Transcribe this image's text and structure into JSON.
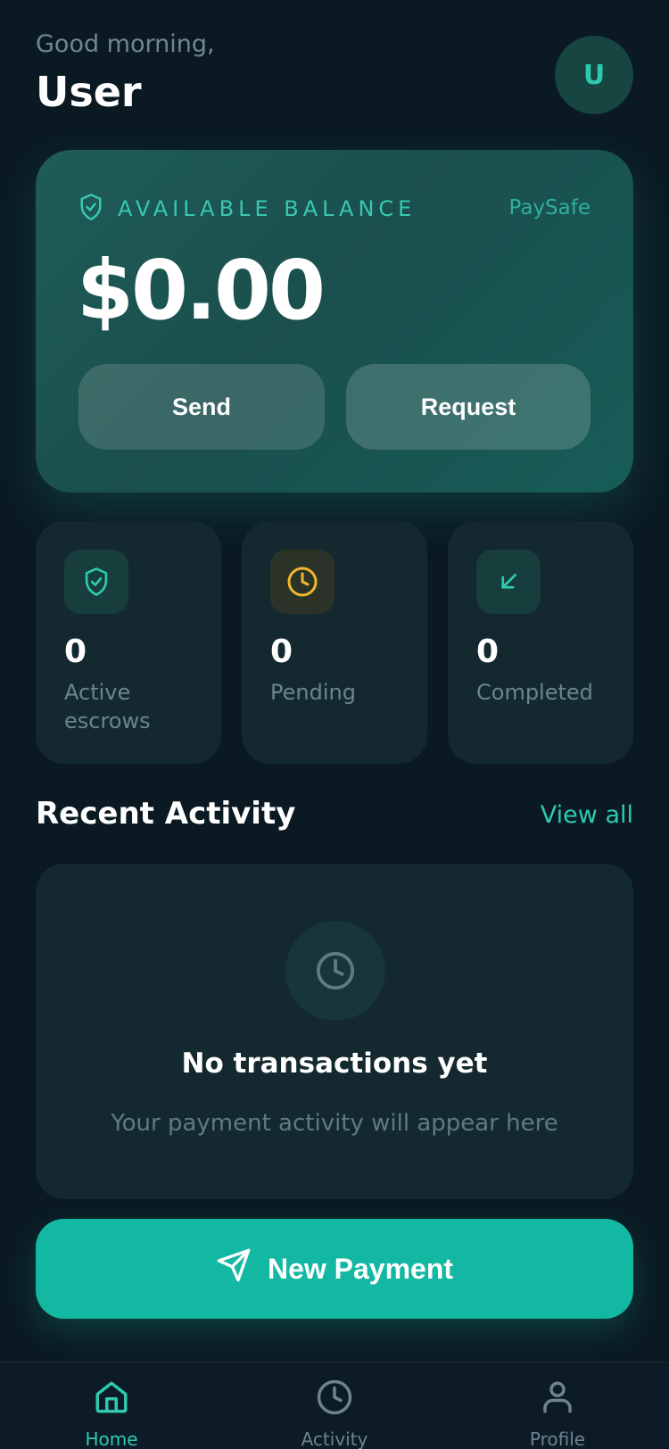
{
  "header": {
    "greeting": "Good morning,",
    "username": "User",
    "avatar_initial": "U"
  },
  "balance_card": {
    "label": "AVAILABLE BALANCE",
    "brand": "PaySafe",
    "amount": "$0.00",
    "send_label": "Send",
    "request_label": "Request",
    "icon": "shield-check-icon"
  },
  "stats": [
    {
      "value": "0",
      "label": "Active escrows",
      "icon": "shield-check-icon",
      "color": "#2ec9b0"
    },
    {
      "value": "0",
      "label": "Pending",
      "icon": "clock-icon",
      "color": "#f0b62e"
    },
    {
      "value": "0",
      "label": "Completed",
      "icon": "arrow-down-left-icon",
      "color": "#2ec9b0"
    }
  ],
  "recent_activity": {
    "title": "Recent Activity",
    "view_all": "View all",
    "empty_title": "No transactions yet",
    "empty_subtitle": "Your payment activity will appear here",
    "empty_icon": "clock-icon"
  },
  "new_payment": {
    "label": "New Payment",
    "icon": "send-icon"
  },
  "nav": {
    "items": [
      {
        "label": "Home",
        "icon": "home-icon",
        "active": true
      },
      {
        "label": "Activity",
        "icon": "clock-icon",
        "active": false
      },
      {
        "label": "Profile",
        "icon": "user-icon",
        "active": false
      }
    ]
  },
  "colors": {
    "background": "#0b1a22",
    "accent": "#2ec9b0",
    "primary_button": "#13b8a3",
    "pending": "#f0b62e"
  }
}
